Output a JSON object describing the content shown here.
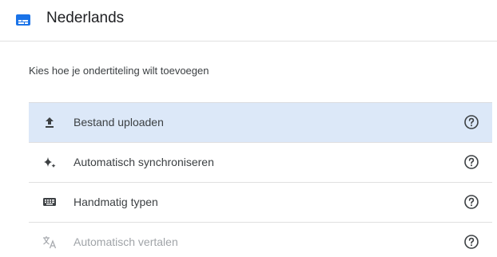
{
  "header": {
    "title": "Nederlands",
    "icon": "subtitles-icon",
    "accent_color": "#1a73e8"
  },
  "subtitle": "Kies hoe je ondertiteling wilt toevoegen",
  "options": [
    {
      "label": "Bestand uploaden",
      "icon": "upload-icon",
      "selected": true,
      "disabled": false,
      "help_icon": "help-circle-icon"
    },
    {
      "label": "Automatisch synchroniseren",
      "icon": "sparkle-icon",
      "selected": false,
      "disabled": false,
      "help_icon": "help-circle-icon"
    },
    {
      "label": "Handmatig typen",
      "icon": "keyboard-icon",
      "selected": false,
      "disabled": false,
      "help_icon": "help-circle-icon"
    },
    {
      "label": "Automatisch vertalen",
      "icon": "translate-icon",
      "selected": false,
      "disabled": true,
      "help_icon": "help-circle-icon"
    }
  ]
}
